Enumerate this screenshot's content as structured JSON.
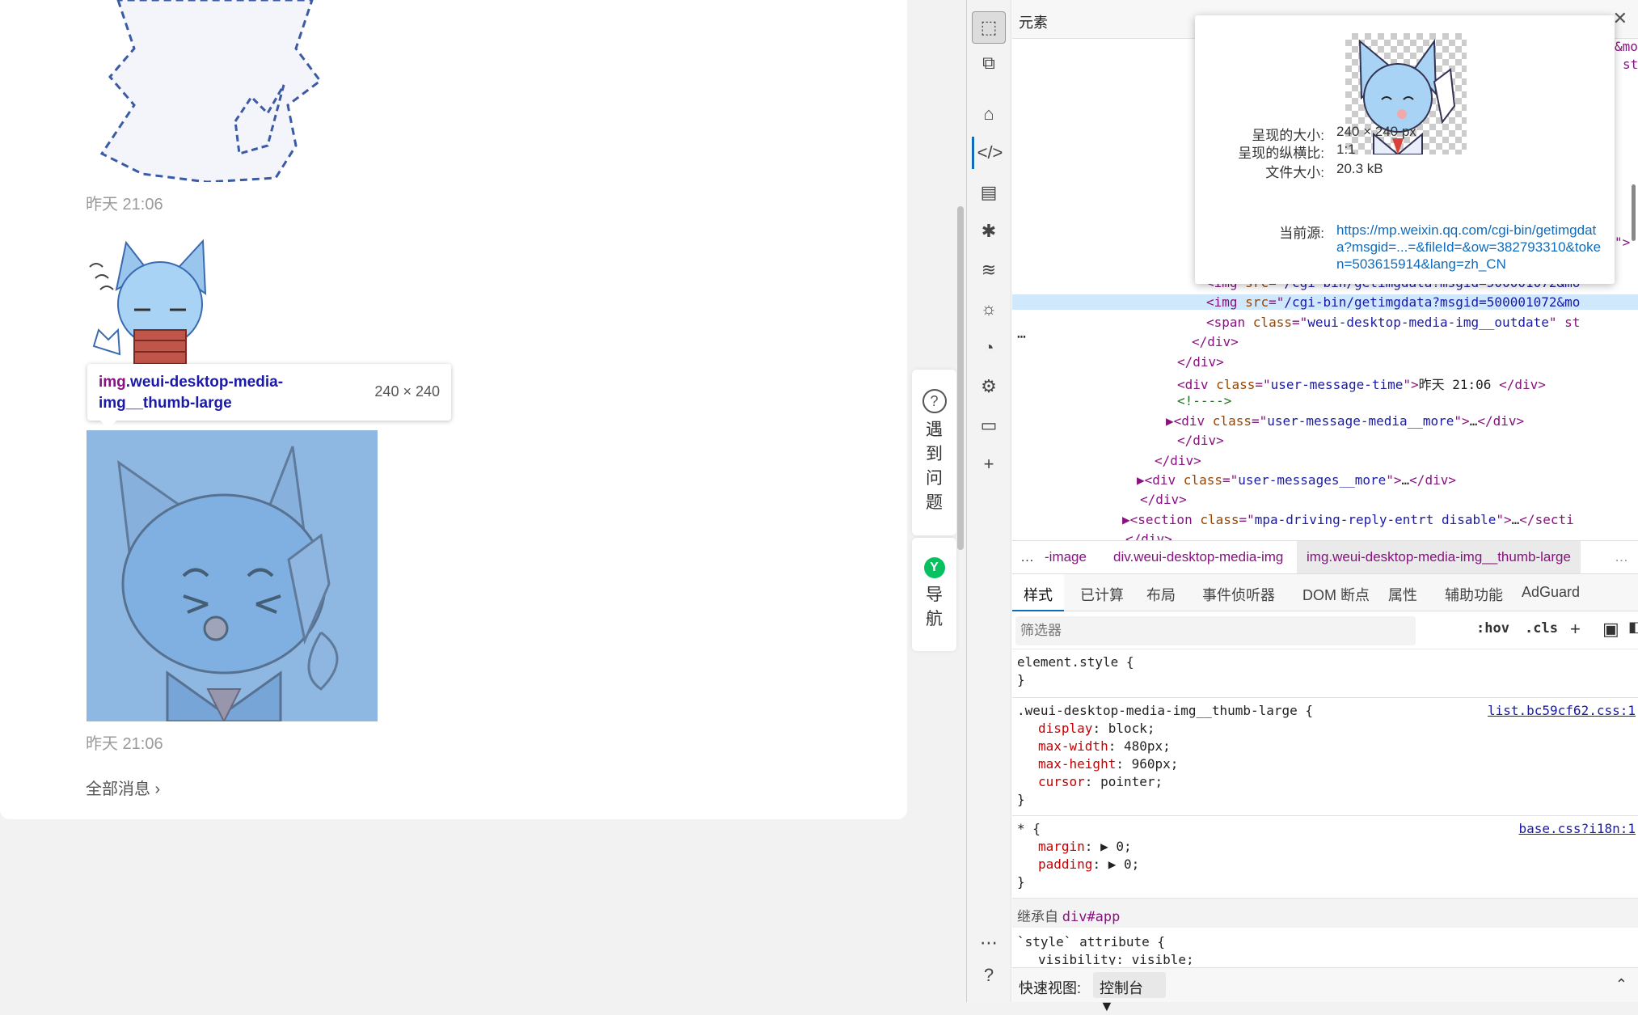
{
  "chat": {
    "messages": [
      {
        "time": "昨天 21:06"
      },
      {
        "time": "昨天 21:06"
      }
    ],
    "all_messages_label": "全部消息 ›",
    "tooltip": {
      "selector_tag": "img",
      "selector_class": ".weui-desktop-media-img__thumb-large",
      "dimensions": "240 × 240"
    }
  },
  "side_float": {
    "help": {
      "label": "遇到问题"
    },
    "nav": {
      "label": "导航",
      "icon": "Y"
    }
  },
  "devtools": {
    "panel_title": "元素",
    "close_label": "✕",
    "activity_icons": [
      "inspect-icon",
      "device-icon",
      "home-icon",
      "elements-icon",
      "console-icon",
      "bug-icon",
      "network-icon",
      "lightbulb-icon",
      "performance-icon",
      "cpu-icon",
      "window-icon",
      "add-icon",
      "more-icon",
      "help-icon"
    ],
    "dom_lines": [
      {
        "indent": 240,
        "html": "&lt;img <span class='an'>src</span>=\"<span class='av'>/cgi-bin/getimgdata?msgid=500001072&amp;mo</span>"
      },
      {
        "indent": 240,
        "html": "&lt;img <span class='an'>src</span>=\"<span class='av'>/cgi-bin/getimgdata?msgid=500001072&amp;mo</span>",
        "selected": true
      },
      {
        "indent": 240,
        "html": "&lt;span <span class='an'>class</span>=\"<span class='av'>weui-desktop-media-img__outdate</span>\" st"
      },
      {
        "indent": 222,
        "html": "&lt;/div&gt;"
      },
      {
        "indent": 204,
        "html": "&lt;/div&gt;"
      },
      {
        "indent": 204,
        "html": "&lt;div <span class='an'>class</span>=\"<span class='av'>user-message-time</span>\"&gt;<span class='tx'>昨天 21:06 </span>&lt;/div&gt;"
      },
      {
        "indent": 204,
        "html": "<span class='cm'>&lt;!----&gt;</span>"
      },
      {
        "indent": 190,
        "html": "▶&lt;div <span class='an'>class</span>=\"<span class='av'>user-message-media__more</span>\"&gt;<span class='tx'>…</span>&lt;/div&gt;"
      },
      {
        "indent": 204,
        "html": "&lt;/div&gt;"
      },
      {
        "indent": 176,
        "html": "&lt;/div&gt;"
      },
      {
        "indent": 154,
        "html": "▶&lt;div <span class='an'>class</span>=\"<span class='av'>user-messages__more</span>\"&gt;<span class='tx'>…</span>&lt;/div&gt;"
      },
      {
        "indent": 158,
        "html": "&lt;/div&gt;"
      },
      {
        "indent": 136,
        "html": "▶&lt;section <span class='an'>class</span>=\"<span class='av'>mpa-driving-reply-entrt disable</span>\"&gt;<span class='tx'>…</span>&lt;/secti"
      },
      {
        "indent": 140,
        "html": "&lt;/div&gt;"
      }
    ],
    "dom_top_fragments": [
      "&mo",
      "st",
      "\">"
    ],
    "image_popover": {
      "rendered_size_label": "呈现的大小:",
      "rendered_size": "240 × 240 px",
      "aspect_label": "呈现的纵横比:",
      "aspect": "1:1",
      "file_size_label": "文件大小:",
      "file_size": "20.3 kB",
      "source_label": "当前源:",
      "source": "https://mp.weixin.qq.com/cgi-bin/getimgdata?msgid=...=&fileId=&ow=382793310&token=503615914&lang=zh_CN"
    },
    "breadcrumbs": [
      "…",
      "-image",
      "div.weui-desktop-media-img",
      "img.weui-desktop-media-img__thumb-large",
      "…"
    ],
    "sub_tabs": [
      "样式",
      "已计算",
      "布局",
      "事件侦听器",
      "DOM 断点",
      "属性",
      "辅助功能",
      "AdGuard"
    ],
    "filter_placeholder": "筛选器",
    "filter_buttons": [
      ":hov",
      ".cls"
    ],
    "styles": {
      "element_style": "element.style {",
      "close_brace": "}",
      "rule1_selector": ".weui-desktop-media-img__thumb-large {",
      "rule1_source": "list.bc59cf62.css:1",
      "rule1_props": [
        {
          "name": "display",
          "value": "block;"
        },
        {
          "name": "max-width",
          "value": "480px;"
        },
        {
          "name": "max-height",
          "value": "960px;"
        },
        {
          "name": "cursor",
          "value": "pointer;"
        }
      ],
      "rule2_selector": "* {",
      "rule2_source": "base.css?i18n:1",
      "rule2_props": [
        {
          "name": "margin",
          "value": "▶ 0;"
        },
        {
          "name": "padding",
          "value": "▶ 0;"
        }
      ],
      "inherit_prefix": "继承自 ",
      "inherit_element": "div#app",
      "style_attr": "`style` attribute {",
      "style_attr_prop": "visibility: visible;"
    },
    "quick_view": {
      "label": "快速视图:",
      "value": "控制台 ▼",
      "expand": "⌃"
    }
  }
}
